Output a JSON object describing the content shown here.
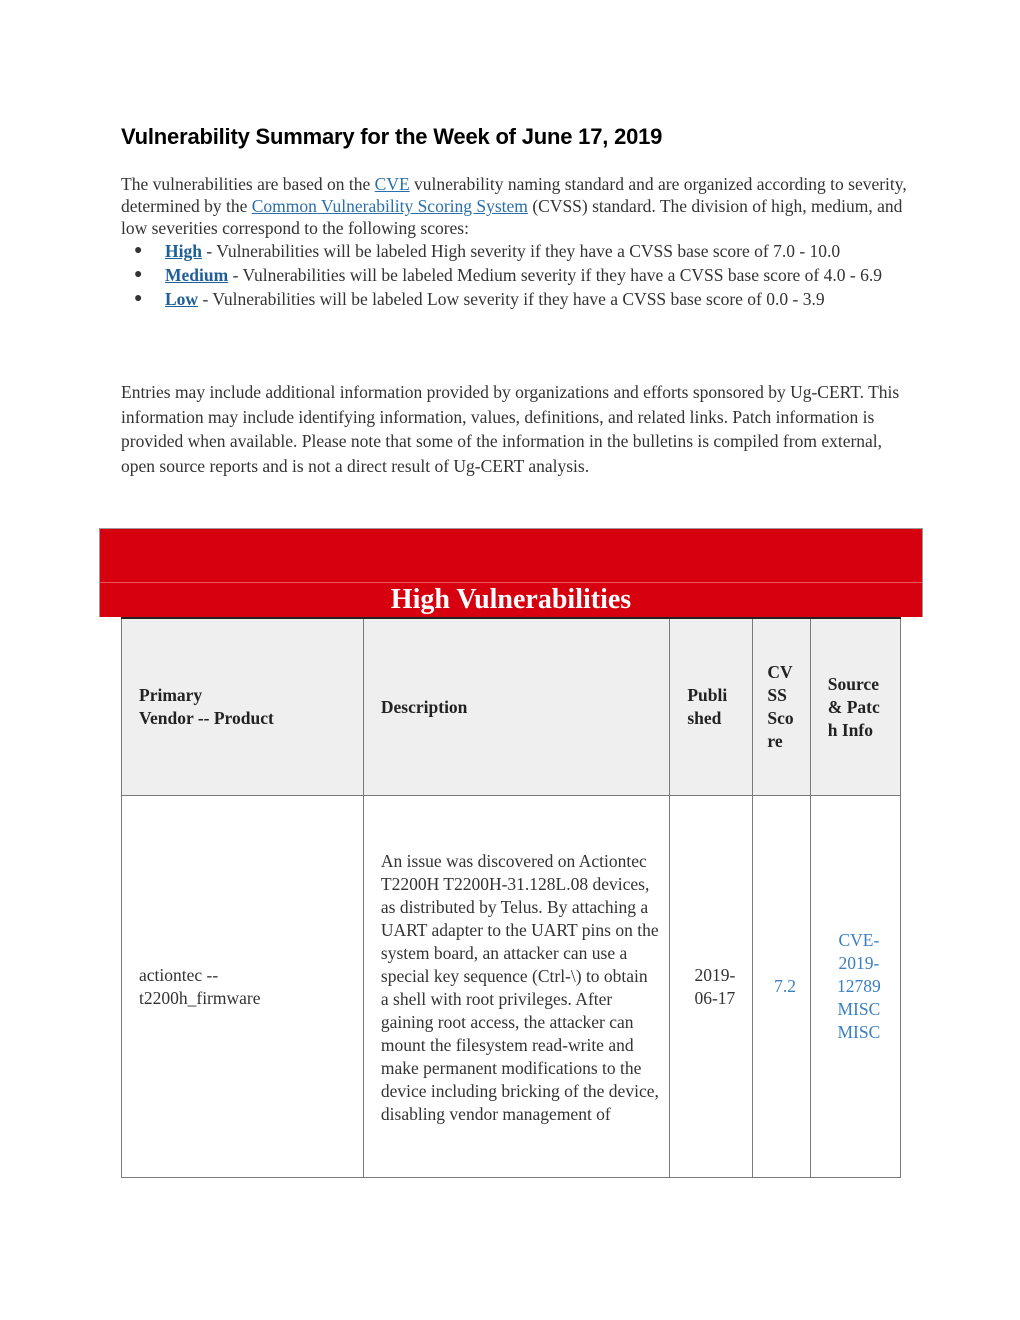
{
  "document": {
    "title": "Vulnerability Summary for the Week of June 17, 2019",
    "intro": {
      "before_cve": "The vulnerabilities are based on the ",
      "cve_link": "CVE",
      "after_cve": " vulnerability naming standard and are organized according to severity, determined by the ",
      "cvss_link": "Common Vulnerability Scoring System",
      "after_cvss": " (CVSS) standard. The division of high, medium, and low severities correspond to the following scores:"
    },
    "severities": [
      {
        "label": "High",
        "text": " - Vulnerabilities will be labeled High severity if they have a CVSS base score of 7.0 - 10.0"
      },
      {
        "label": "Medium",
        "text": " - Vulnerabilities will be labeled Medium severity if they have a CVSS base score of 4.0 - 6.9"
      },
      {
        "label": "Low",
        "text": " - Vulnerabilities will be labeled Low severity if they have a CVSS base score of 0.0 - 3.9"
      }
    ],
    "entries_note": "Entries may include additional information provided by organizations and efforts sponsored by Ug-CERT. This information may include identifying information, values, definitions, and related links. Patch information is provided when available. Please note that some of the information in the bulletins is compiled from external, open source reports and is not a direct result of Ug-CERT analysis."
  },
  "section": {
    "title": "High Vulnerabilities",
    "banner_color": "#d7000f"
  },
  "table": {
    "headers": {
      "vendor_line1": "Primary",
      "vendor_line2": "Vendor -- Product",
      "description": "Description",
      "published": "Published",
      "cvss": "CVSS Score",
      "source": "Source & Patch Info"
    },
    "rows": [
      {
        "vendor": "actiontec --",
        "product": "t2200h_firmware",
        "description": "An issue was discovered on Actiontec T2200H T2200H-31.128L.08 devices, as distributed by Telus. By attaching a UART adapter to the UART pins on the system board, an attacker can use a special key sequence (Ctrl-\\) to obtain a shell with root privileges. After gaining root access, the attacker can mount the filesystem read-write and make permanent modifications to the device including bricking of the device, disabling vendor management of",
        "published": "2019-06-17",
        "cvss": "7.2",
        "sources": [
          "CVE-2019-12789",
          "MISC",
          "MISC"
        ]
      }
    ]
  }
}
